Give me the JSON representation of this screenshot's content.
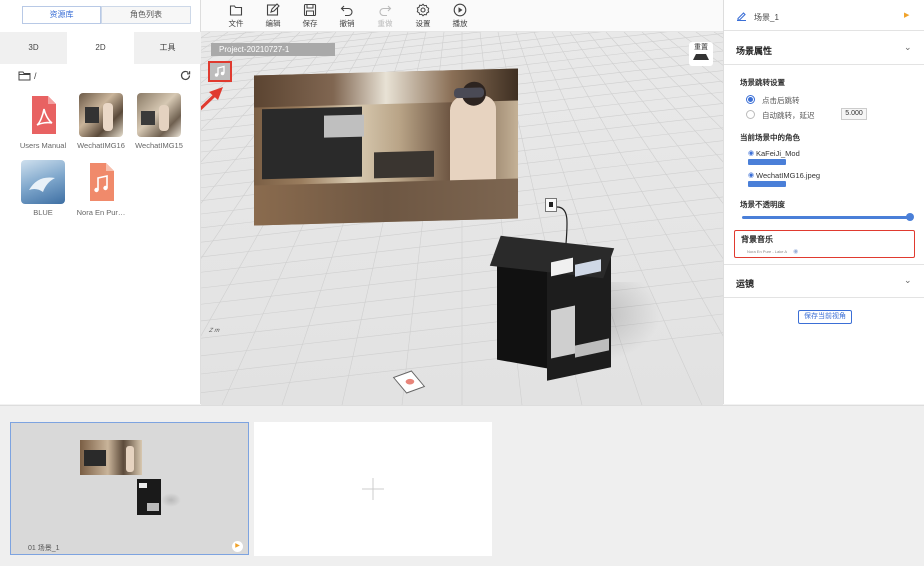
{
  "left_panel": {
    "tabs": [
      "资源库",
      "角色列表"
    ],
    "subtabs": [
      "3D",
      "2D",
      "工具"
    ],
    "path": "/",
    "assets": [
      {
        "label": "Users Manual",
        "icon": "pdf-icon"
      },
      {
        "label": "WechatIMG16",
        "icon": "image-thumbnail"
      },
      {
        "label": "WechatIMG15",
        "icon": "image-thumbnail"
      },
      {
        "label": "BLUE",
        "icon": "image-thumbnail"
      },
      {
        "label": "Nora En Pur…",
        "icon": "music-file-icon"
      }
    ]
  },
  "toolbar": {
    "items": [
      {
        "label": "文件",
        "icon": "folder-icon"
      },
      {
        "label": "编辑",
        "icon": "edit-icon"
      },
      {
        "label": "保存",
        "icon": "save-icon"
      },
      {
        "label": "撤销",
        "icon": "undo-icon"
      },
      {
        "label": "重做",
        "icon": "redo-icon",
        "disabled": true
      },
      {
        "label": "设置",
        "icon": "settings-icon"
      },
      {
        "label": "播放",
        "icon": "play-icon"
      }
    ]
  },
  "viewport": {
    "project_name": "Project-20210727-1",
    "reset_label": "重置",
    "axis_label": "Z m"
  },
  "right_panel": {
    "scene_name": "场景_1",
    "scene_props_title": "场景属性",
    "jump_title": "场景跳转设置",
    "jump_options": [
      "点击后跳转",
      "自动跳转，延迟"
    ],
    "jump_selected": 0,
    "delay_value": "5.000",
    "roles_title": "当前场景中的角色",
    "roles": [
      "KaFeiJi_Mod",
      "WechatIMG16.jpeg"
    ],
    "opacity_title": "场景不透明度",
    "opacity_value": 1.0,
    "bgm_title": "背景音乐",
    "bgm_value": "Nora En Pure - Lake A",
    "camera_title": "运镜",
    "save_view_button": "保存当前视角"
  },
  "timeline": {
    "scenes": [
      {
        "label": "01  场景_1"
      }
    ]
  },
  "colors": {
    "accent": "#3b6fd6",
    "highlight": "#e03a2f",
    "bar": "#4a7fd8"
  }
}
